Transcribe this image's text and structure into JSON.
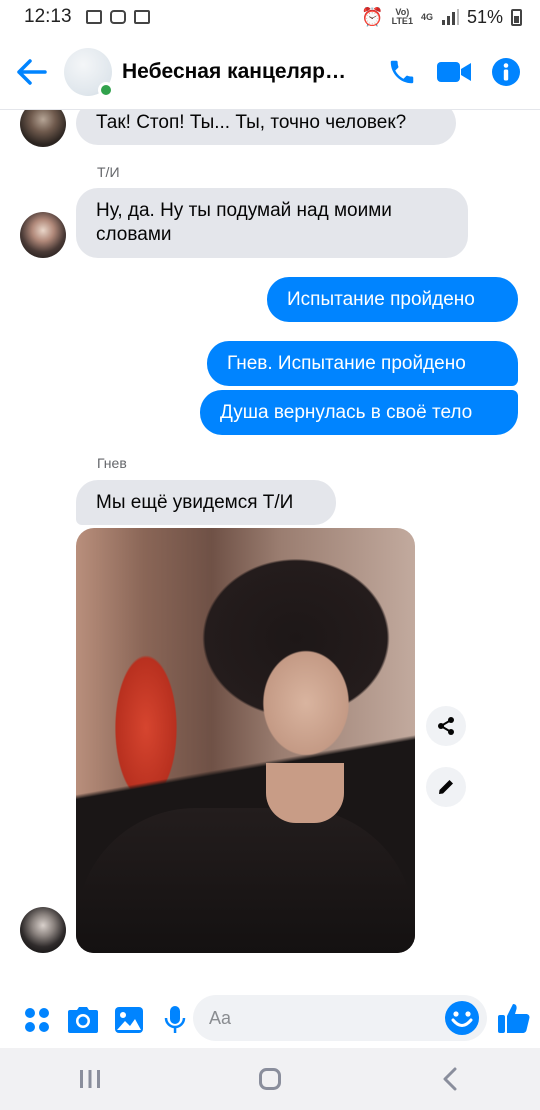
{
  "status_bar": {
    "time": "12:13",
    "network_top": "Vo)",
    "network_bottom": "LTE1",
    "network_type": "4G",
    "battery": "51%"
  },
  "header": {
    "title": "Небесная канцелярия",
    "accent_color": "#0084ff",
    "online_color": "#31a24c"
  },
  "messages": [
    {
      "direction": "incoming",
      "text": "Так! Стоп! Ты... Ты, точно человек?"
    },
    {
      "direction": "incoming",
      "sender": "Т/И",
      "text": "Ну, да. Ну ты подумай над моими словами"
    },
    {
      "direction": "outgoing",
      "text": "Испытание пройдено"
    },
    {
      "direction": "outgoing",
      "text": "Гнев. Испытание  пройдено"
    },
    {
      "direction": "outgoing",
      "text": "Душа вернулась в своё тело"
    },
    {
      "direction": "incoming",
      "sender": "Гнев",
      "text": "Мы ещё увидемся Т/И"
    }
  ],
  "photo_actions": [
    "share-icon",
    "edit-icon"
  ],
  "composer": {
    "placeholder": "Aa",
    "icons": [
      "apps-icon",
      "camera-icon",
      "gallery-icon",
      "microphone-icon",
      "emoji-icon",
      "thumbs-up-icon"
    ]
  },
  "navbar": {
    "icons": [
      "recent-apps-icon",
      "home-icon",
      "back-icon"
    ]
  }
}
